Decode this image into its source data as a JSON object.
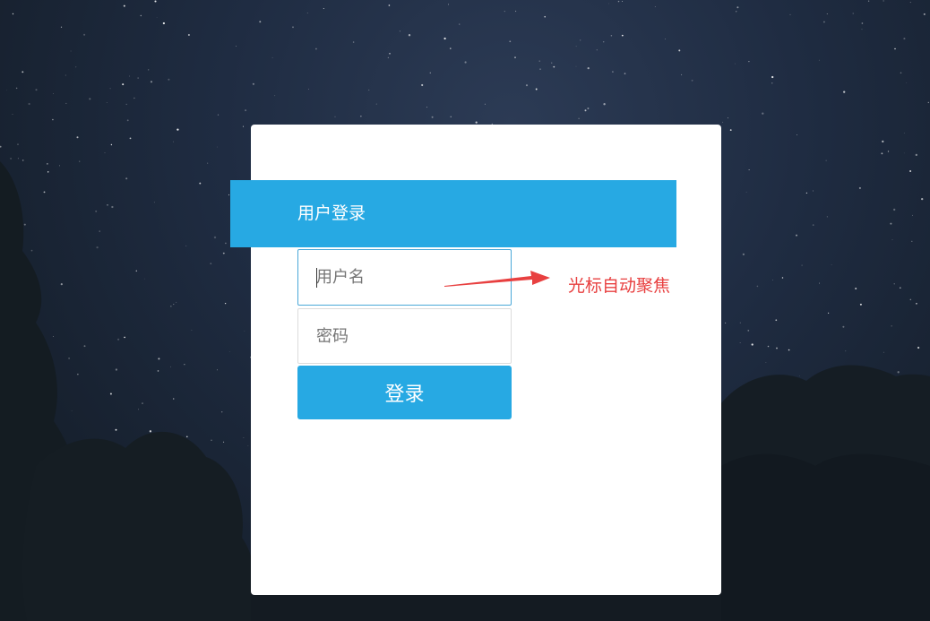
{
  "banner": {
    "title": "用户登录"
  },
  "form": {
    "username_placeholder": "用户名",
    "password_placeholder": "密码",
    "login_label": "登录"
  },
  "annotation": {
    "text": "光标自动聚焦"
  },
  "colors": {
    "accent": "#27a9e3",
    "annotation": "#e84040",
    "card": "#ffffff"
  },
  "icons": {
    "annotation_pointer": "arrow-right-icon"
  }
}
